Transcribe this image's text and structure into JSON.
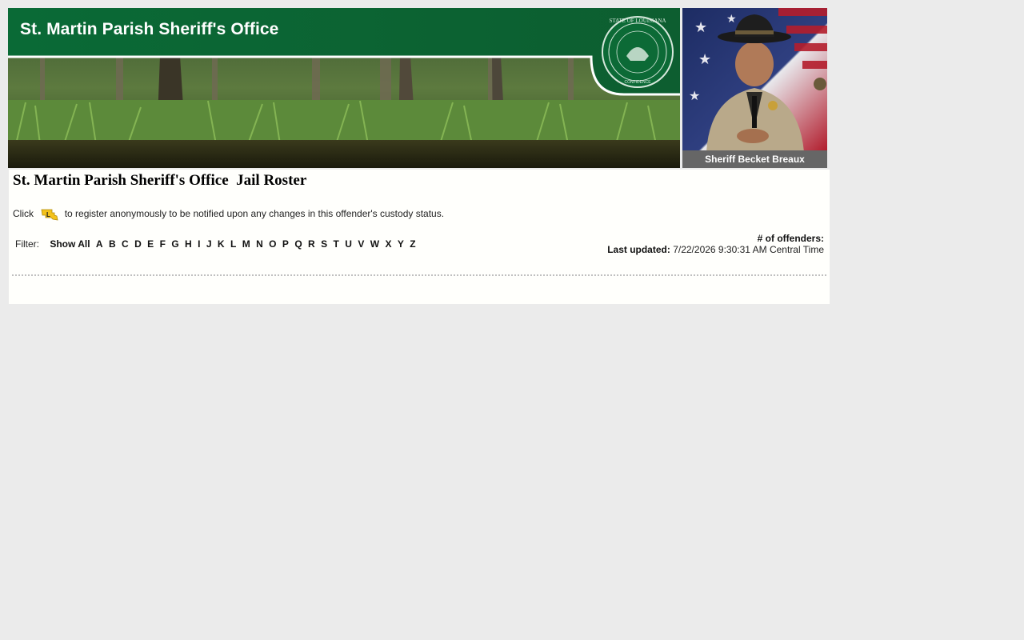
{
  "header": {
    "office_name": "St. Martin Parish Sheriff's Office",
    "seal_alt": "State of Louisiana seal",
    "colors": {
      "banner_green": "#0b6b37",
      "caption_gray": "#666666"
    }
  },
  "sheriff": {
    "caption": "Sheriff Becket Breaux"
  },
  "main": {
    "title": "St. Martin Parish Sheriff's Office  Jail Roster",
    "notify": {
      "lead": "Click",
      "icon": "louisiana-notify-icon",
      "text": "to register anonymously to be notified upon any changes in this offender's custody status."
    },
    "filter": {
      "label": "Filter:",
      "show_all": "Show All",
      "letters": [
        "A",
        "B",
        "C",
        "D",
        "E",
        "F",
        "G",
        "H",
        "I",
        "J",
        "K",
        "L",
        "M",
        "N",
        "O",
        "P",
        "Q",
        "R",
        "S",
        "T",
        "U",
        "V",
        "W",
        "X",
        "Y",
        "Z"
      ]
    },
    "stats": {
      "offenders_label": "# of offenders:",
      "offenders_value": "",
      "updated_label": "Last updated:",
      "updated_value": "7/22/2026 9:30:31 AM Central Time"
    }
  }
}
